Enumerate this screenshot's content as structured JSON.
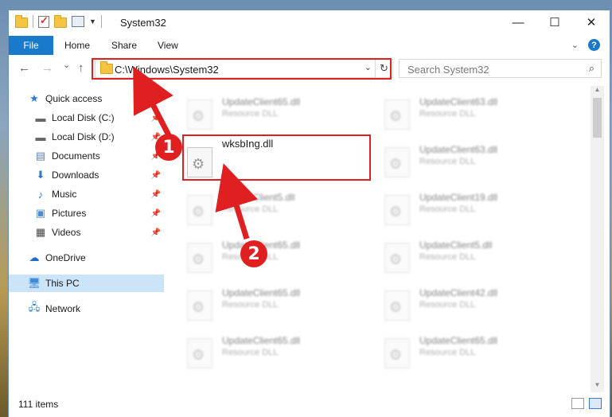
{
  "window": {
    "title": "System32",
    "controls": {
      "minimize": "—",
      "maximize": "☐",
      "close": "✕"
    }
  },
  "ribbon": {
    "tabs": [
      "File",
      "Home",
      "Share",
      "View"
    ],
    "collapse_icon": "chevron-down-icon",
    "help_label": "?"
  },
  "nav": {
    "back": "←",
    "forward": "→",
    "recent": "⌄",
    "up": "↑",
    "address": "C:\\Windows\\System32",
    "search_placeholder": "Search System32"
  },
  "sidebar": {
    "items": [
      {
        "label": "Quick access",
        "icon": "star-icon",
        "pinned": false
      },
      {
        "label": "Local Disk (C:)",
        "icon": "drive-icon",
        "pinned": true
      },
      {
        "label": "Local Disk (D:)",
        "icon": "drive-icon",
        "pinned": true
      },
      {
        "label": "Documents",
        "icon": "documents-icon",
        "pinned": true
      },
      {
        "label": "Downloads",
        "icon": "download-icon",
        "pinned": true
      },
      {
        "label": "Music",
        "icon": "music-icon",
        "pinned": true
      },
      {
        "label": "Pictures",
        "icon": "pictures-icon",
        "pinned": true
      },
      {
        "label": "Videos",
        "icon": "videos-icon",
        "pinned": true
      },
      {
        "label": "OneDrive",
        "icon": "cloud-icon",
        "pinned": false
      },
      {
        "label": "This PC",
        "icon": "computer-icon",
        "pinned": false,
        "selected": true
      },
      {
        "label": "Network",
        "icon": "network-icon",
        "pinned": false
      }
    ]
  },
  "files": {
    "left": [
      {
        "name": "UpdateClient65.dll",
        "type": "Resource DLL",
        "blurred": true
      },
      {
        "name": "wksbIng.dll",
        "type": "",
        "blurred": false
      },
      {
        "name": "UpdateClient5.dll",
        "type": "Resource DLL",
        "blurred": true
      },
      {
        "name": "UpdateClient65.dll",
        "type": "Resource DLL",
        "blurred": true
      },
      {
        "name": "UpdateClient65.dll",
        "type": "Resource DLL",
        "blurred": true
      },
      {
        "name": "UpdateClient65.dll",
        "type": "Resource DLL",
        "blurred": true
      }
    ],
    "right": [
      {
        "name": "UpdateClient63.dll",
        "type": "Resource DLL",
        "blurred": true
      },
      {
        "name": "UpdateClient63.dll",
        "type": "Resource DLL",
        "blurred": true
      },
      {
        "name": "UpdateClient19.dll",
        "type": "Resource DLL",
        "blurred": true
      },
      {
        "name": "UpdateClient5.dll",
        "type": "Resource DLL",
        "blurred": true
      },
      {
        "name": "UpdateClient42.dll",
        "type": "Resource DLL",
        "blurred": true
      },
      {
        "name": "UpdateClient65.dll",
        "type": "Resource DLL",
        "blurred": true
      }
    ]
  },
  "status": {
    "item_count": "111 items"
  },
  "annotations": {
    "step1": "1",
    "step2": "2",
    "color": "#e02020"
  }
}
